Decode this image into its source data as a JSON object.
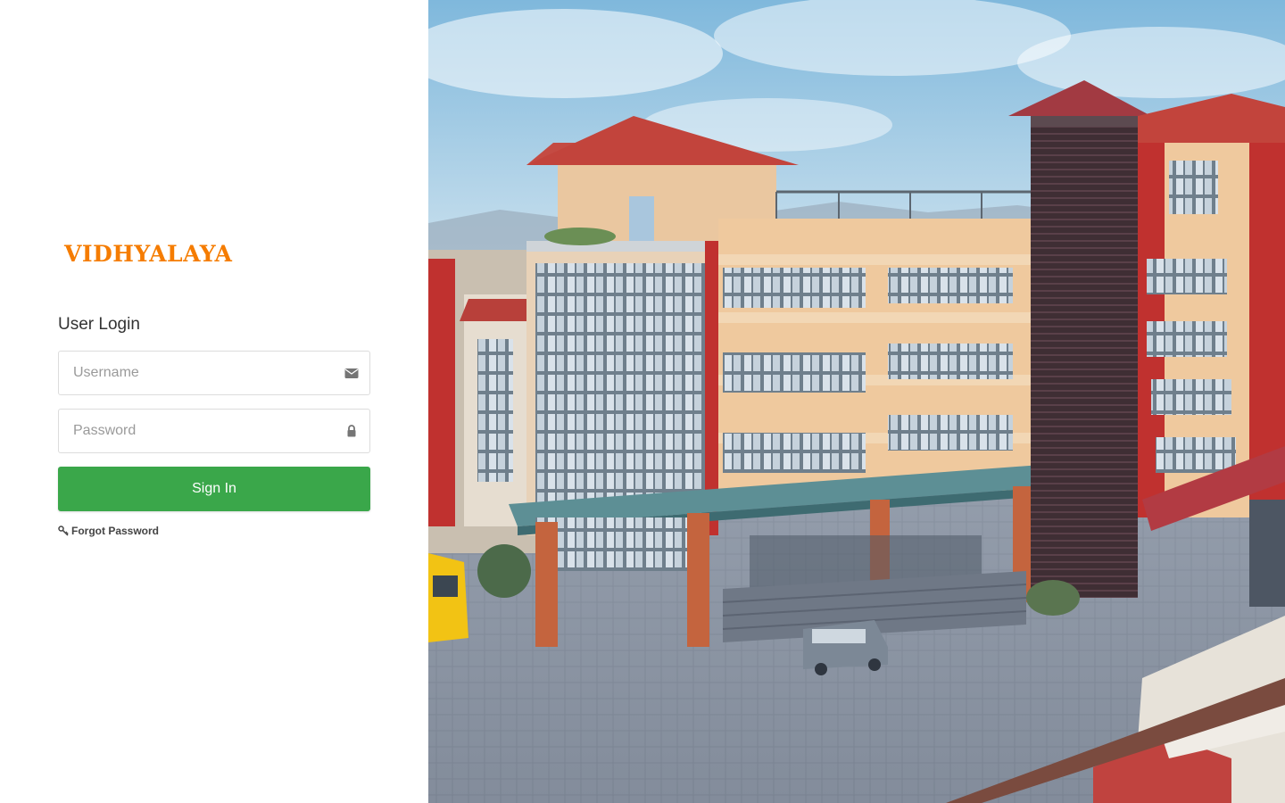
{
  "brand": {
    "logo_text": "VIDHYALAYA",
    "accent_color": "#f57c00"
  },
  "login": {
    "title": "User Login",
    "username": {
      "placeholder": "Username",
      "value": "",
      "icon": "envelope-icon"
    },
    "password": {
      "placeholder": "Password",
      "value": "",
      "icon": "lock-icon"
    },
    "signin_label": "Sign In",
    "signin_color": "#3aa74a",
    "forgot_label": "Forgot Password",
    "forgot_icon": "key-icon"
  },
  "hero": {
    "image": "school-building-photo"
  }
}
